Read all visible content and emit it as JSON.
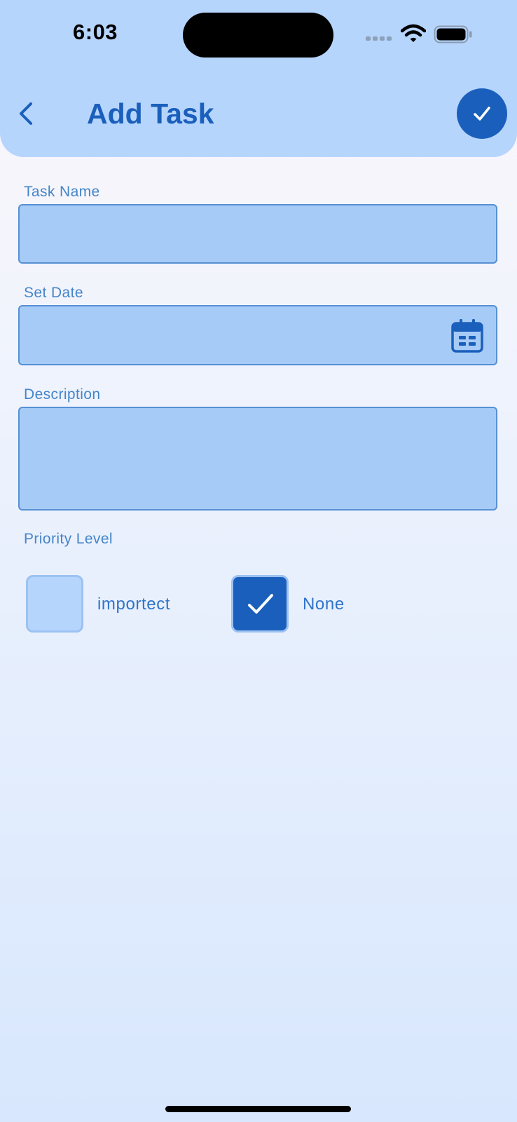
{
  "status_bar": {
    "time": "6:03",
    "icons": [
      "signal-icon",
      "wifi-icon",
      "battery-icon"
    ]
  },
  "header": {
    "title": "Add Task",
    "back_icon": "chevron-left-icon",
    "save_icon": "checkmark-icon"
  },
  "form": {
    "task_name": {
      "label": "Task Name",
      "value": ""
    },
    "set_date": {
      "label": "Set Date",
      "value": "",
      "icon": "calendar-icon"
    },
    "description": {
      "label": "Description",
      "value": ""
    },
    "priority": {
      "label": "Priority Level",
      "options": [
        {
          "label": "importect",
          "checked": false
        },
        {
          "label": "None",
          "checked": true
        }
      ]
    }
  },
  "colors": {
    "header_bg": "#b6d5fd",
    "accent": "#1a5fbb",
    "field_bg": "#a7cbf7",
    "label": "#4585c8"
  }
}
